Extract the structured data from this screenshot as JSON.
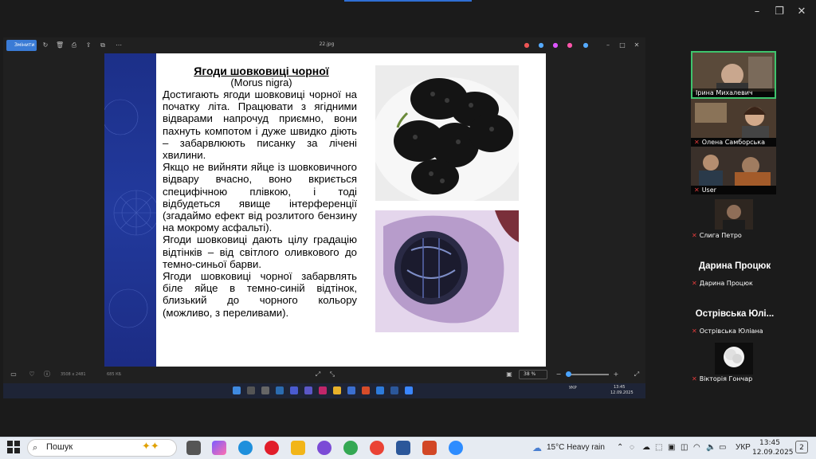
{
  "image_file": {
    "name": "22.jpg"
  },
  "photo_toolbar": {
    "edit_label": "Змінити"
  },
  "slide": {
    "title": "Ягоди шовковиці чорної",
    "subtitle": "(Morus nigra)",
    "paragraphs": [
      "Достигають ягоди шовковиці чорної на початку літа. Працювати з ягідними відварами напрочуд приємно, вони пахнуть компотом і дуже швидко діють – забарвлюють писанку за лічені хвилини.",
      "Якщо не вийняти яйце із шовковичного відвару вчасно, воно вкриється специфічною плівкою, і тоді відбудеться явище інтерференції (згадаймо ефект від розлитого бензину на мокрому асфальті).",
      "Ягоди шовковиці дають цілу градацію відтінків – від світлого оливкового до темно-синьої барви.",
      "Ягоди шовковиці чорної забарвлять біле яйце в темно-синій відтінок, близький до чорного кольору (можливо, з переливами)."
    ]
  },
  "photo_status": {
    "dimensions": "3508 x 2481",
    "size": "685 КБ",
    "zoom": "38 %"
  },
  "inner_tray": {
    "lang": "УКР",
    "time": "13:45",
    "date": "12.09.2025"
  },
  "participants": [
    {
      "name": "Ірина Михалевич"
    },
    {
      "name": "Олена Самборська"
    },
    {
      "name": "User"
    },
    {
      "name": "Слига Петро"
    },
    {
      "name": "Дарина Процюк",
      "big": "Дарина Процюк"
    },
    {
      "name": "Острівська Юліана",
      "big": "Острівська Юлі..."
    },
    {
      "name": "Вікторія Гончар"
    }
  ],
  "taskbar": {
    "search_placeholder": "Пошук",
    "weather": "15°C  Heavy rain",
    "lang": "УКР",
    "time": "13:45",
    "date": "12.09.2025",
    "notifications": "2"
  },
  "colors": {
    "accent": "#3a7bd5",
    "slide_band": "#1f3494",
    "active_speaker": "#3ec46d"
  }
}
